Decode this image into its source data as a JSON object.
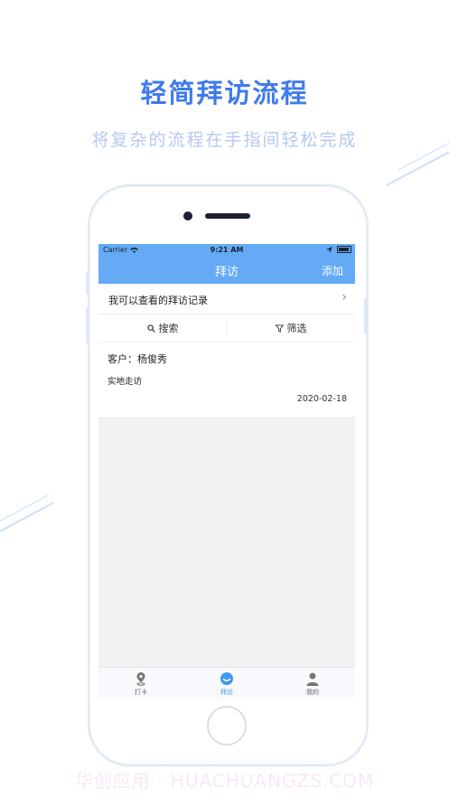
{
  "promo": {
    "title": "轻简拜访流程",
    "subtitle": "将复杂的流程在手指间轻松完成"
  },
  "status_bar": {
    "carrier": "Carrier",
    "time": "9:21 AM"
  },
  "nav": {
    "title": "拜访",
    "add_label": "添加"
  },
  "records_link": {
    "label": "我可以查看的拜访记录",
    "arrow": "›"
  },
  "toolbar": {
    "search_label": "搜索",
    "filter_label": "筛选"
  },
  "visits": [
    {
      "customer": "客户：杨俊秀",
      "type": "实地走访",
      "date": "2020-02-18"
    }
  ],
  "tabs": [
    {
      "label": "打卡",
      "icon": "location-pin-icon",
      "active": false
    },
    {
      "label": "拜访",
      "icon": "smile-icon",
      "active": true
    },
    {
      "label": "我的",
      "icon": "person-icon",
      "active": false
    }
  ],
  "colors": {
    "accent": "#64aaf5",
    "promo_title": "#3f7bea",
    "active_tab": "#3c97f0"
  },
  "watermark": "华创应用 · HUACHUANGZS.COM"
}
